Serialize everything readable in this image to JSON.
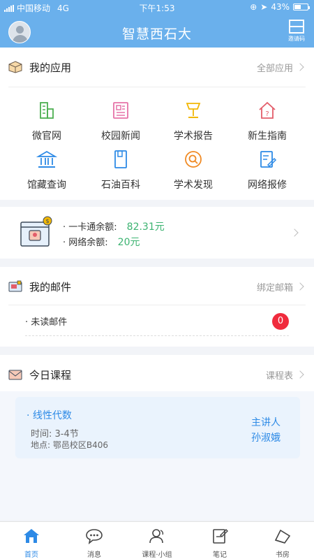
{
  "status_bar": {
    "carrier": "中国移动",
    "network": "4G",
    "time": "下午1:53",
    "battery": "43%"
  },
  "header": {
    "title": "智慧西石大",
    "scan_label": "邀请码"
  },
  "apps_section": {
    "title": "我的应用",
    "link": "全部应用",
    "items": [
      {
        "label": "微官网",
        "icon": "buildings-icon",
        "color": "#4caf50"
      },
      {
        "label": "校园新闻",
        "icon": "newspaper-icon",
        "color": "#e673a8"
      },
      {
        "label": "学术报告",
        "icon": "lamp-icon",
        "color": "#f2b705"
      },
      {
        "label": "新生指南",
        "icon": "house-question-icon",
        "color": "#e35d6a"
      },
      {
        "label": "馆藏查询",
        "icon": "library-icon",
        "color": "#2d8ae6"
      },
      {
        "label": "石油百科",
        "icon": "book-icon",
        "color": "#2d8ae6"
      },
      {
        "label": "学术发现",
        "icon": "search-icon",
        "color": "#f08a24"
      },
      {
        "label": "网络报修",
        "icon": "repair-form-icon",
        "color": "#2d8ae6"
      }
    ]
  },
  "balance": {
    "card_label": "· 一卡通余额:",
    "card_value": "82.31元",
    "net_label": "· 网络余额:",
    "net_value": "20元"
  },
  "mail_section": {
    "title": "我的邮件",
    "link": "绑定邮箱",
    "unread_label": "· 未读邮件",
    "unread_count": "0"
  },
  "course_section": {
    "title": "今日课程",
    "link": "课程表",
    "course": {
      "name": "· 线性代数",
      "time": "时间:  3-4节",
      "place": "地点:  鄂邑校区B406",
      "lecturer_label": "主讲人",
      "lecturer_name": "孙淑娥"
    }
  },
  "tabs": [
    {
      "label": "首页",
      "icon": "home-icon",
      "active": true
    },
    {
      "label": "消息",
      "icon": "chat-bubble-icon",
      "active": false
    },
    {
      "label": "课程·小组",
      "icon": "user-group-icon",
      "active": false
    },
    {
      "label": "笔记",
      "icon": "note-icon",
      "active": false
    },
    {
      "label": "书房",
      "icon": "bookshelf-icon",
      "active": false
    }
  ],
  "colors": {
    "header": "#6ab0ec",
    "accent": "#2d8ae6",
    "money": "#3cb371",
    "badge": "#f02b3d"
  }
}
